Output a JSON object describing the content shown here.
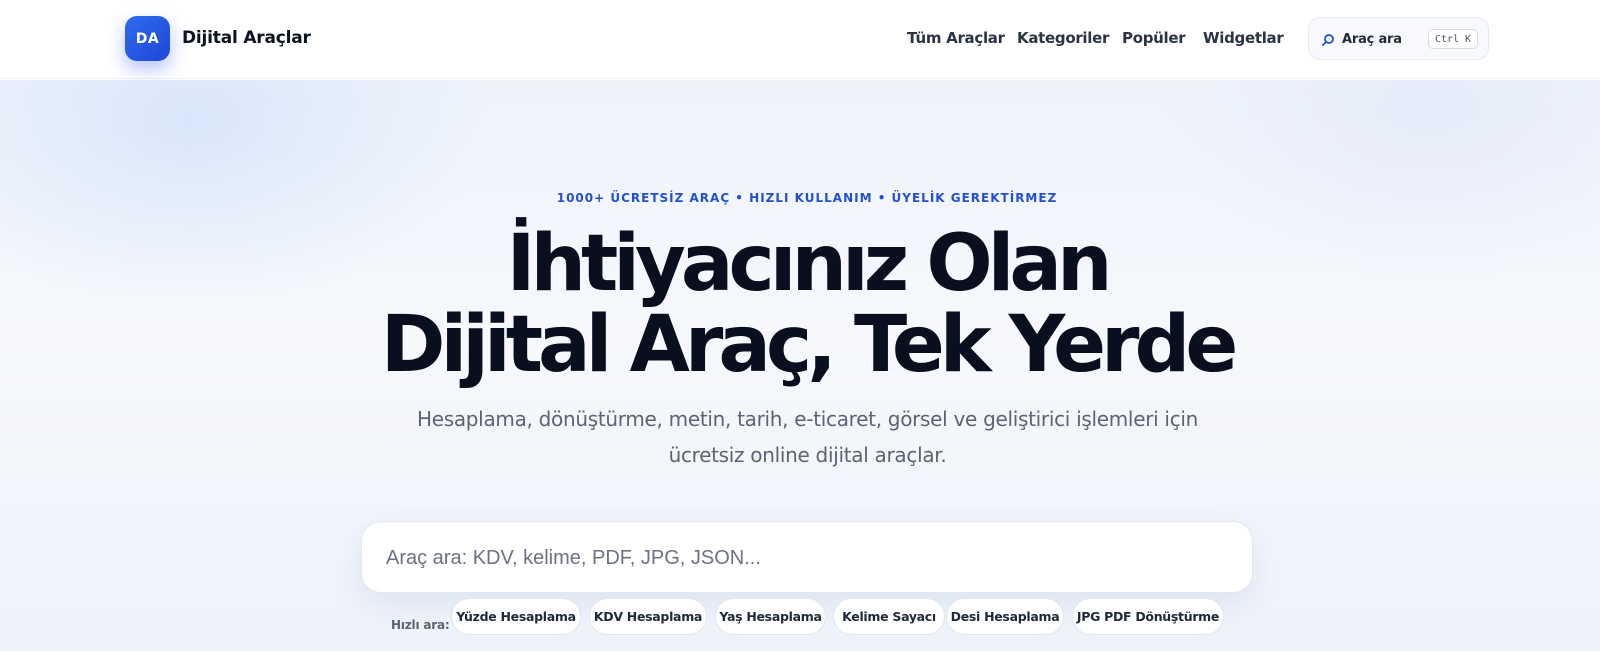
{
  "header": {
    "logo_badge": "DA",
    "brand_name": "Dijital Araçlar",
    "nav": [
      "Tüm Araçlar",
      "Kategoriler",
      "Popüler",
      "Widgetlar"
    ],
    "search": {
      "label": "Araç ara",
      "shortcut": "Ctrl K",
      "icon": "search-icon"
    }
  },
  "hero": {
    "eyebrow": "1000+ ÜCRETSİZ ARAÇ • HIZLI KULLANIM • ÜYELİK GEREKTİRMEZ",
    "headline_line1": "İhtiyacınız Olan",
    "headline_line2": "Dijital Araç, Tek Yerde",
    "subtitle": "Hesaplama, dönüştürme, metin, tarih, e-ticaret, görsel ve geliştirici işlemleri için ücretsiz online dijital araçlar.",
    "search_placeholder": "Araç ara: KDV, kelime, PDF, JPG, JSON...",
    "quick_label": "Hızlı ara:",
    "quick_chips": [
      "Yüzde Hesaplama",
      "KDV Hesaplama",
      "Yaş Hesaplama",
      "Kelime Sayacı",
      "Desi Hesaplama",
      "JPG PDF Dönüştürme"
    ]
  },
  "colors": {
    "accent": "#2350d3",
    "logo_gradient_start": "#2f6bf0",
    "logo_gradient_end": "#1d47d6",
    "headline": "#0a0f1f",
    "hero_background": "#eef3fb"
  }
}
